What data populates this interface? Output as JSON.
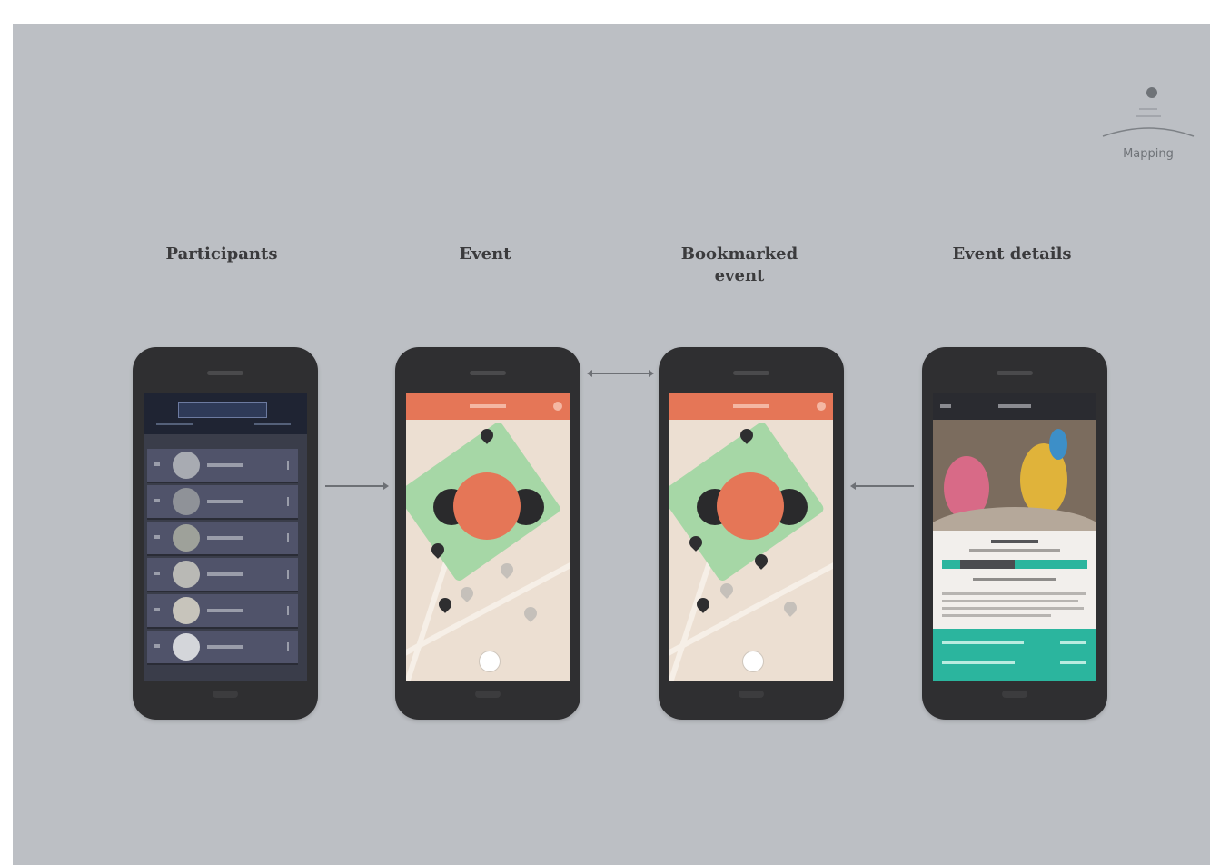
{
  "logo": {
    "text": "Mapping"
  },
  "screens": [
    {
      "title": "Participants"
    },
    {
      "title": "Event"
    },
    {
      "title": "Bookmarked event"
    },
    {
      "title": "Event details"
    }
  ],
  "colors": {
    "background": "#bcbfc4",
    "phone_body": "#2f2f31",
    "accent_coral": "#e57657",
    "park_green": "#a6d7a6",
    "teal": "#2bb59e",
    "participants_bg": "#3a3d4a"
  },
  "icons": {
    "logo": "map-pin-icon",
    "map_pin": "map-pin-icon",
    "locate_button": "location-icon"
  }
}
